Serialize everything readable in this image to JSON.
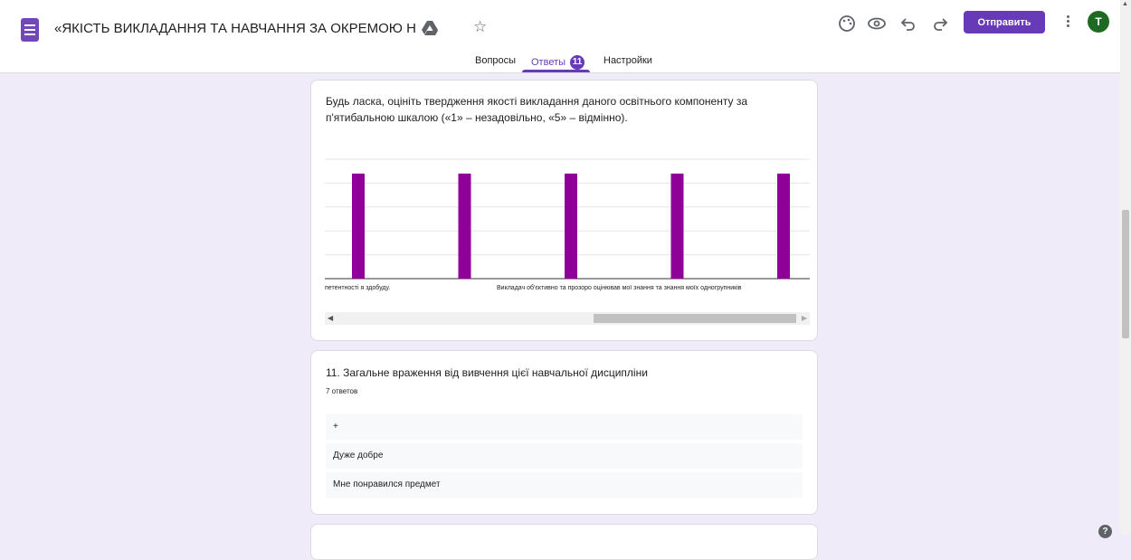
{
  "header": {
    "doc_title": "«ЯКІСТЬ ВИКЛАДАННЯ ТА НАВЧАННЯ ЗА ОКРЕМОЮ НАВЧАЛЬНОЮ Д",
    "send_label": "Отправить",
    "avatar_initial": "T",
    "icons": [
      "forms-logo-icon",
      "drive-icon",
      "star-icon",
      "palette-icon",
      "eye-icon",
      "undo-icon",
      "redo-icon",
      "more-vert-icon"
    ]
  },
  "tabs": {
    "questions": "Вопросы",
    "responses": "Ответы",
    "responses_count": "11",
    "settings": "Настройки"
  },
  "question1": {
    "title": "Будь ласка, оцініть твердження якості викладання даного освітнього компоненту за п'ятибальною шкалою («1» – незадовільно, «5» – відмінно)."
  },
  "chart_data": {
    "type": "bar",
    "title": "",
    "x_labels": [
      "петентності я здобуду.",
      "Викладач об'єктивно та прозоро оцінював мої знання та знання моїх одногрупників"
    ],
    "bar_count": 5,
    "gridlines": 5,
    "values": [
      0.88,
      0.88,
      0.88,
      0.88,
      0.88
    ],
    "colors": {
      "bar": "#8e0097",
      "grid": "#e5e5e5",
      "axis": "#333333"
    }
  },
  "question2": {
    "title": "11. Загальне враження від вивчення цієї навчальної дисципліни",
    "count": "7 ответов",
    "answers": [
      "+",
      "Дуже добре",
      "Мне понравился предмет"
    ]
  },
  "colors": {
    "accent": "#673ab7",
    "background": "#f0ebf8"
  }
}
